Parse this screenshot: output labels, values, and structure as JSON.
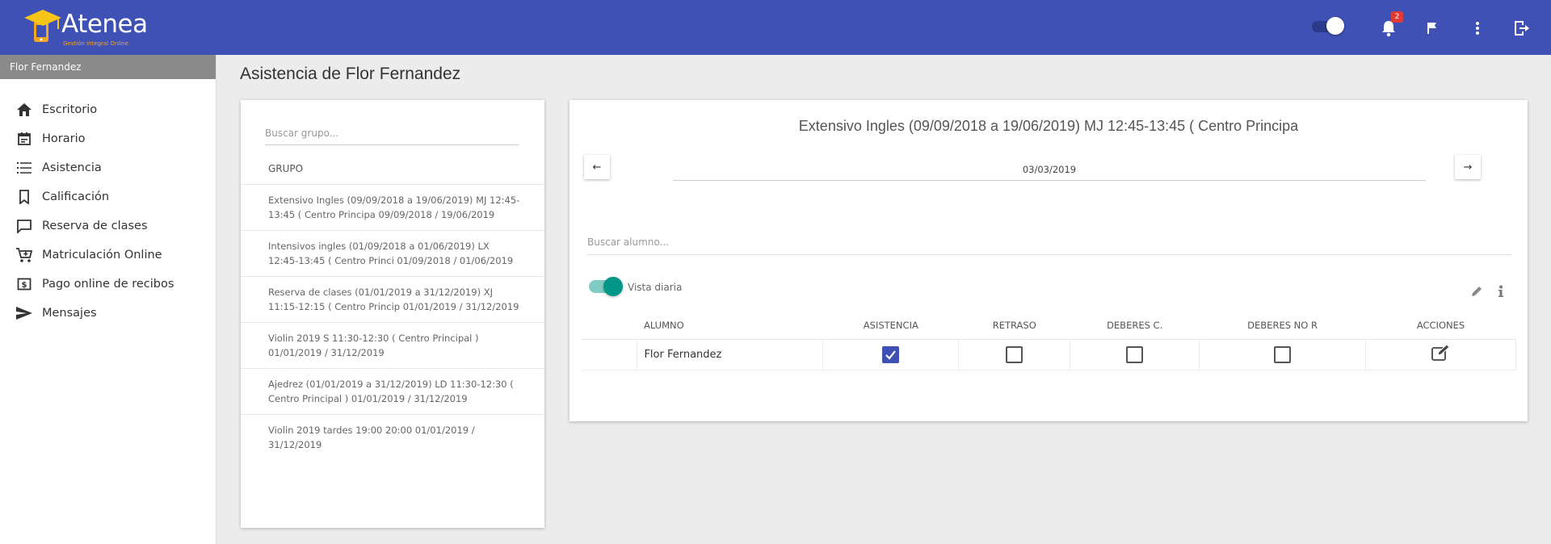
{
  "app": {
    "name": "Atenea",
    "tagline": "Gestión Integral Online",
    "notification_count": "2"
  },
  "sidebar": {
    "user": "Flor Fernandez",
    "items": [
      {
        "label": "Escritorio",
        "icon": "home-icon"
      },
      {
        "label": "Horario",
        "icon": "calendar-icon"
      },
      {
        "label": "Asistencia",
        "icon": "list-icon"
      },
      {
        "label": "Calificación",
        "icon": "bookmark-icon"
      },
      {
        "label": "Reserva de clases",
        "icon": "chat-icon"
      },
      {
        "label": "Matriculación Online",
        "icon": "cart-icon"
      },
      {
        "label": "Pago online de recibos",
        "icon": "dollar-icon"
      },
      {
        "label": "Mensajes",
        "icon": "send-icon"
      }
    ]
  },
  "page": {
    "title": "Asistencia de Flor Fernandez"
  },
  "groups": {
    "search_placeholder": "Buscar grupo...",
    "header": "GRUPO",
    "items": [
      "Extensivo Ingles (09/09/2018 a 19/06/2019) MJ 12:45-13:45 ( Centro Principa 09/09/2018 / 19/06/2019",
      "Intensivos ingles (01/09/2018 a 01/06/2019) LX 12:45-13:45 ( Centro Princi 01/09/2018 / 01/06/2019",
      "Reserva de clases (01/01/2019 a 31/12/2019) XJ 11:15-12:15 ( Centro Princip 01/01/2019 / 31/12/2019",
      "Violin 2019 S 11:30-12:30 ( Centro Principal ) 01/01/2019 / 31/12/2019",
      "Ajedrez (01/01/2019 a 31/12/2019) LD 11:30-12:30 ( Centro Principal ) 01/01/2019 / 31/12/2019",
      "Violin 2019 tardes 19:00 20:00 01/01/2019 / 31/12/2019"
    ]
  },
  "attendance": {
    "group_title": "Extensivo Ingles (09/09/2018 a 19/06/2019) MJ 12:45-13:45 ( Centro Principa",
    "prev_label": "←",
    "next_label": "→",
    "date": "03/03/2019",
    "student_search_placeholder": "Buscar alumno...",
    "daily_view_label": "Vista diaria",
    "daily_view_on": true,
    "columns": [
      "ALUMNO",
      "ASISTENCIA",
      "RETRASO",
      "DEBERES C.",
      "DEBERES NO R",
      "ACCIONES"
    ],
    "rows": [
      {
        "student": "Flor Fernandez",
        "asistencia": true,
        "retraso": false,
        "deberes_c": false,
        "deberes_no_r": false
      }
    ]
  },
  "colors": {
    "primary": "#3f51b5",
    "accent": "#009688",
    "badge": "#e53935",
    "logo_accent": "#f5a623"
  }
}
